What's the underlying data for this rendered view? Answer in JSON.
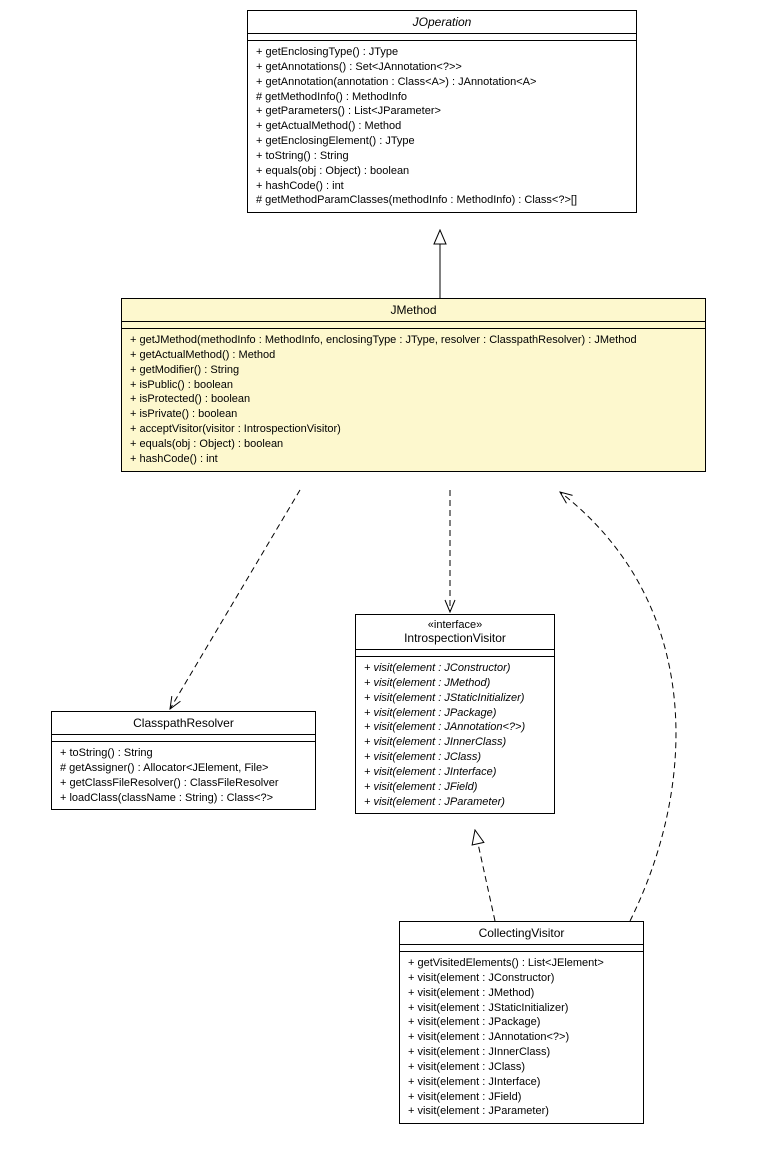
{
  "classes": {
    "joperation": {
      "name": "JOperation",
      "abstract": true,
      "ops": [
        "+ getEnclosingType() : JType",
        "+ getAnnotations() : Set<JAnnotation<?>>",
        "+ getAnnotation(annotation : Class<A>) : JAnnotation<A>",
        "# getMethodInfo() : MethodInfo",
        "+ getParameters() : List<JParameter>",
        "+ getActualMethod() : Method",
        "+ getEnclosingElement() : JType",
        "+ toString() : String",
        "+ equals(obj : Object) : boolean",
        "+ hashCode() : int",
        "# getMethodParamClasses(methodInfo : MethodInfo) : Class<?>[]"
      ]
    },
    "jmethod": {
      "name": "JMethod",
      "ops": [
        "+ getJMethod(methodInfo : MethodInfo, enclosingType : JType, resolver : ClasspathResolver) : JMethod",
        "+ getActualMethod() : Method",
        "+ getModifier() : String",
        "+ isPublic() : boolean",
        "+ isProtected() : boolean",
        "+ isPrivate() : boolean",
        "+ acceptVisitor(visitor : IntrospectionVisitor)",
        "+ equals(obj : Object) : boolean",
        "+ hashCode() : int"
      ]
    },
    "classpathresolver": {
      "name": "ClasspathResolver",
      "ops": [
        "+ toString() : String",
        "# getAssigner() : Allocator<JElement, File>",
        "+ getClassFileResolver() : ClassFileResolver",
        "+ loadClass(className : String) : Class<?>"
      ]
    },
    "introspectionvisitor": {
      "stereo": "«interface»",
      "name": "IntrospectionVisitor",
      "ops_abstract": true,
      "ops": [
        "+ visit(element : JConstructor)",
        "+ visit(element : JMethod)",
        "+ visit(element : JStaticInitializer)",
        "+ visit(element : JPackage)",
        "+ visit(element : JAnnotation<?>)",
        "+ visit(element : JInnerClass)",
        "+ visit(element : JClass)",
        "+ visit(element : JInterface)",
        "+ visit(element : JField)",
        "+ visit(element : JParameter)"
      ]
    },
    "collectingvisitor": {
      "name": "CollectingVisitor",
      "ops": [
        "+ getVisitedElements() : List<JElement>",
        "+ visit(element : JConstructor)",
        "+ visit(element : JMethod)",
        "+ visit(element : JStaticInitializer)",
        "+ visit(element : JPackage)",
        "+ visit(element : JAnnotation<?>)",
        "+ visit(element : JInnerClass)",
        "+ visit(element : JClass)",
        "+ visit(element : JInterface)",
        "+ visit(element : JField)",
        "+ visit(element : JParameter)"
      ]
    }
  },
  "chart_data": {
    "type": "uml-class-diagram",
    "classes": [
      {
        "id": "JOperation",
        "abstract": true
      },
      {
        "id": "JMethod",
        "highlight": true
      },
      {
        "id": "ClasspathResolver"
      },
      {
        "id": "IntrospectionVisitor",
        "stereotype": "interface"
      },
      {
        "id": "CollectingVisitor"
      }
    ],
    "relations": [
      {
        "from": "JMethod",
        "to": "JOperation",
        "type": "generalization"
      },
      {
        "from": "JMethod",
        "to": "ClasspathResolver",
        "type": "dependency"
      },
      {
        "from": "JMethod",
        "to": "IntrospectionVisitor",
        "type": "dependency"
      },
      {
        "from": "CollectingVisitor",
        "to": "IntrospectionVisitor",
        "type": "realization"
      },
      {
        "from": "CollectingVisitor",
        "to": "JMethod",
        "type": "dependency"
      }
    ]
  }
}
